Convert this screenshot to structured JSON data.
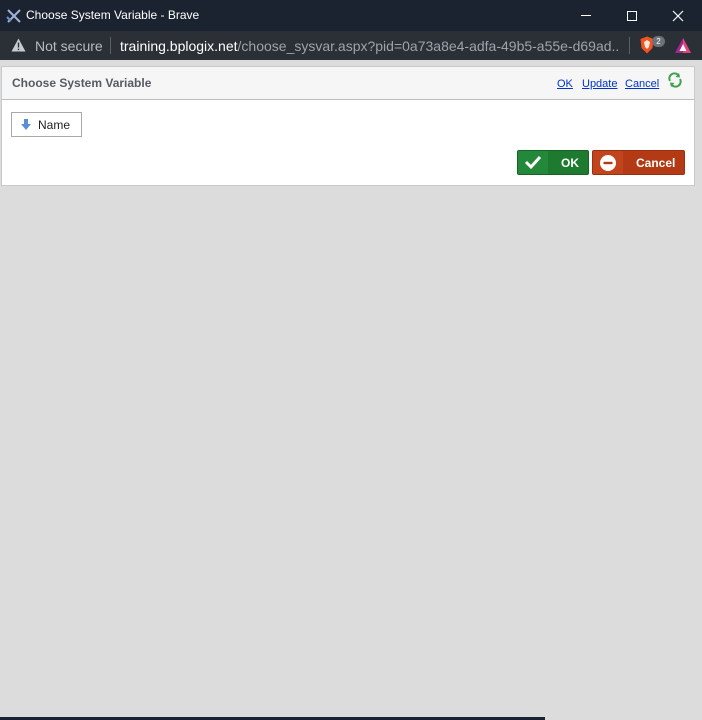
{
  "window": {
    "title": "Choose System Variable - Brave",
    "app_icon": "brave-x-icon",
    "controls": [
      "minimize-icon",
      "maximize-icon",
      "close-icon"
    ]
  },
  "addressbar": {
    "security_label": "Not secure",
    "url_host": "training.bplogix.net",
    "url_path": "/choose_sysvar.aspx?pid=0a73a8e4-adfa-49b5-a55e-d69ad...",
    "shield_count": "2",
    "icons": [
      "warning-icon",
      "brave-shield-icon",
      "brave-rewards-icon"
    ]
  },
  "dialog": {
    "title": "Choose System Variable",
    "links": {
      "ok": "OK",
      "update": "Update",
      "cancel": "Cancel"
    },
    "column_header": "Name",
    "buttons": {
      "ok": "OK",
      "cancel": "Cancel"
    }
  },
  "colors": {
    "titlebar": "#1b2330",
    "addressbar": "#2b2f36",
    "ok_button": "#1e7a2f",
    "cancel_button": "#b33a14",
    "link": "#0033cc",
    "background": "#dcdcdc"
  }
}
